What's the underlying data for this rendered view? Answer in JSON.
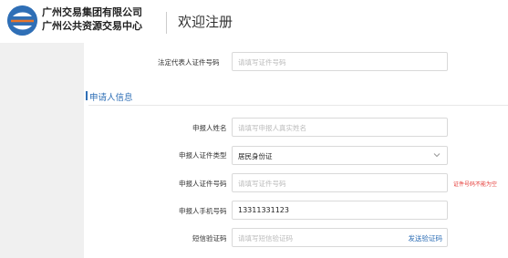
{
  "header": {
    "org_line1": "广州交易集团有限公司",
    "org_line2": "广州公共资源交易中心",
    "page_title": "欢迎注册"
  },
  "form": {
    "legal_rep_id": {
      "label": "法定代表人证件号码",
      "placeholder": "请填写证件号码"
    },
    "applicant_section_title": "申请人信息",
    "applicant_name": {
      "label": "申报人姓名",
      "placeholder": "请填写申报人真实姓名"
    },
    "id_type": {
      "label": "申报人证件类型",
      "value": "居民身份证"
    },
    "id_number": {
      "label": "申报人证件号码",
      "placeholder": "请填写证件号码",
      "error": "证件号码不能为空"
    },
    "phone": {
      "label": "申报人手机号码",
      "value": "13311331123"
    },
    "sms_code": {
      "label": "短信验证码",
      "placeholder": "请填写短信验证码",
      "button": "发送验证码"
    }
  },
  "colors": {
    "accent": "#2f6fb6",
    "error": "#e53935"
  }
}
